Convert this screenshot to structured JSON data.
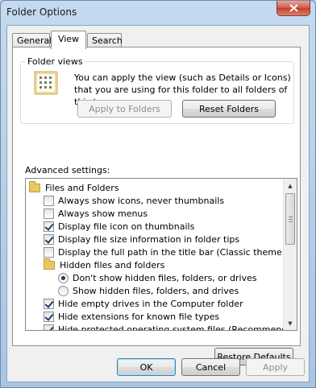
{
  "window": {
    "title": "Folder Options"
  },
  "tabs": [
    {
      "label": "General",
      "active": false
    },
    {
      "label": "View",
      "active": true
    },
    {
      "label": "Search",
      "active": false
    }
  ],
  "folder_views": {
    "legend": "Folder views",
    "description": "You can apply the view (such as Details or Icons) that you are using for this folder to all folders of this type.",
    "apply_label": "Apply to Folders",
    "reset_label": "Reset Folders"
  },
  "advanced": {
    "label": "Advanced settings:",
    "items": [
      {
        "type": "folder",
        "label": "Files and Folders",
        "level": 0
      },
      {
        "type": "checkbox",
        "label": "Always show icons, never thumbnails",
        "checked": false,
        "level": 1
      },
      {
        "type": "checkbox",
        "label": "Always show menus",
        "checked": false,
        "level": 1
      },
      {
        "type": "checkbox",
        "label": "Display file icon on thumbnails",
        "checked": true,
        "level": 1
      },
      {
        "type": "checkbox",
        "label": "Display file size information in folder tips",
        "checked": true,
        "level": 1
      },
      {
        "type": "checkbox",
        "label": "Display the full path in the title bar (Classic theme only)",
        "checked": false,
        "level": 1
      },
      {
        "type": "folder",
        "label": "Hidden files and folders",
        "level": 1
      },
      {
        "type": "radio",
        "label": "Don't show hidden files, folders, or drives",
        "checked": true,
        "level": 2
      },
      {
        "type": "radio",
        "label": "Show hidden files, folders, and drives",
        "checked": false,
        "level": 2
      },
      {
        "type": "checkbox",
        "label": "Hide empty drives in the Computer folder",
        "checked": true,
        "level": 1
      },
      {
        "type": "checkbox",
        "label": "Hide extensions for known file types",
        "checked": true,
        "level": 1
      },
      {
        "type": "checkbox",
        "label": "Hide protected operating system files (Recommended)",
        "checked": true,
        "level": 1
      }
    ],
    "restore_label": "Restore Defaults"
  },
  "footer": {
    "ok_label": "OK",
    "cancel_label": "Cancel",
    "apply_label": "Apply"
  },
  "colors": {
    "title_bar": "#c4daf0",
    "close_button": "#c1402f",
    "dialog_bg": "#f0f0f0"
  }
}
